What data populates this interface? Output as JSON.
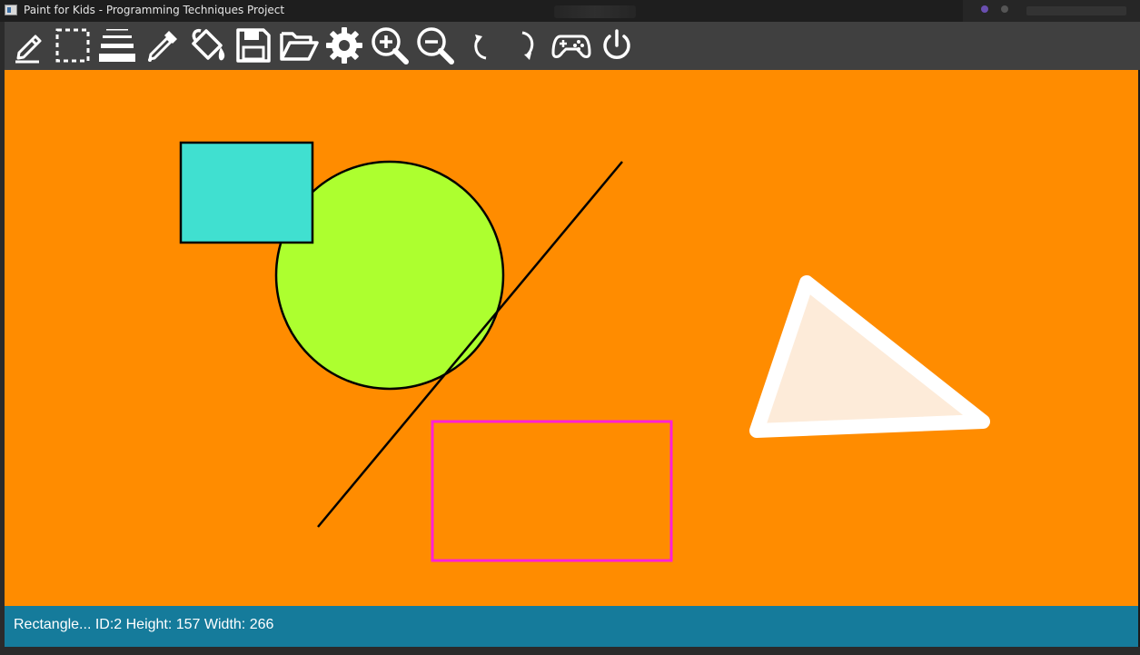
{
  "window": {
    "title": "Paint for Kids - Programming Techniques Project"
  },
  "toolbar": {
    "items": [
      {
        "icon": "pencil-icon"
      },
      {
        "icon": "select-icon"
      },
      {
        "icon": "border-width-icon"
      },
      {
        "icon": "color-picker-icon"
      },
      {
        "icon": "paint-bucket-icon"
      },
      {
        "icon": "save-icon"
      },
      {
        "icon": "open-folder-icon"
      },
      {
        "icon": "gear-icon"
      },
      {
        "icon": "zoom-in-icon"
      },
      {
        "icon": "zoom-out-icon"
      },
      {
        "icon": "undo-icon"
      },
      {
        "icon": "redo-icon"
      },
      {
        "icon": "gamepad-icon"
      },
      {
        "icon": "power-icon"
      }
    ]
  },
  "canvas": {
    "background_color": "#ff8c00",
    "shapes": [
      {
        "type": "rectangle",
        "fill": "#40e0d0",
        "stroke": "#000000"
      },
      {
        "type": "circle",
        "fill": "#adff2f",
        "stroke": "#000000"
      },
      {
        "type": "line",
        "stroke": "#000000"
      },
      {
        "type": "rectangle",
        "fill": "none",
        "stroke": "#ff1fd6",
        "selected": true
      },
      {
        "type": "triangle",
        "fill": "#fdebd9",
        "stroke": "#ffffff"
      }
    ]
  },
  "statusbar": {
    "text": "Rectangle... ID:2 Height: 157 Width: 266",
    "color": "#157b9b"
  }
}
